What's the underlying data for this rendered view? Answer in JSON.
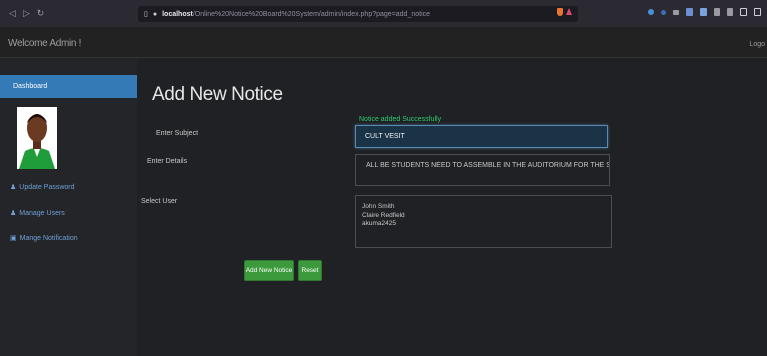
{
  "browser": {
    "back_icon": "arrow-left",
    "forward_icon": "arrow-right",
    "reload_icon": "reload",
    "url_host": "localhost",
    "url_path": "/Online%20Notice%20Board%20System/admin/index.php?page=add_notice"
  },
  "header": {
    "brand": "Welcome Admin !",
    "logout": "Logo"
  },
  "sidebar": {
    "dashboard": "Dashboard",
    "items": [
      {
        "label": "Update Password",
        "icon": "user-icon"
      },
      {
        "label": "Manage Users",
        "icon": "user-icon"
      },
      {
        "label": "Mange Notification",
        "icon": "notification-icon"
      }
    ]
  },
  "form": {
    "title": "Add New Notice",
    "subject_label": "Enter Subject",
    "success_message": "Notice added Successfully",
    "subject_value": "CULT VESIT",
    "details_label": "Enter Details",
    "details_value": "ALL BE STUDENTS NEED TO ASSEMBLE IN THE AUDITORIUM FOR THE SEMINAR",
    "user_label": "Select User",
    "users": [
      "John Smith",
      "Claire Redfield",
      "akuma2425"
    ],
    "submit_label": "Add New Notice",
    "reset_label": "Reset"
  },
  "colors": {
    "accent": "#337ab7",
    "success": "#2ecc71",
    "button": "#3c9a3c"
  }
}
